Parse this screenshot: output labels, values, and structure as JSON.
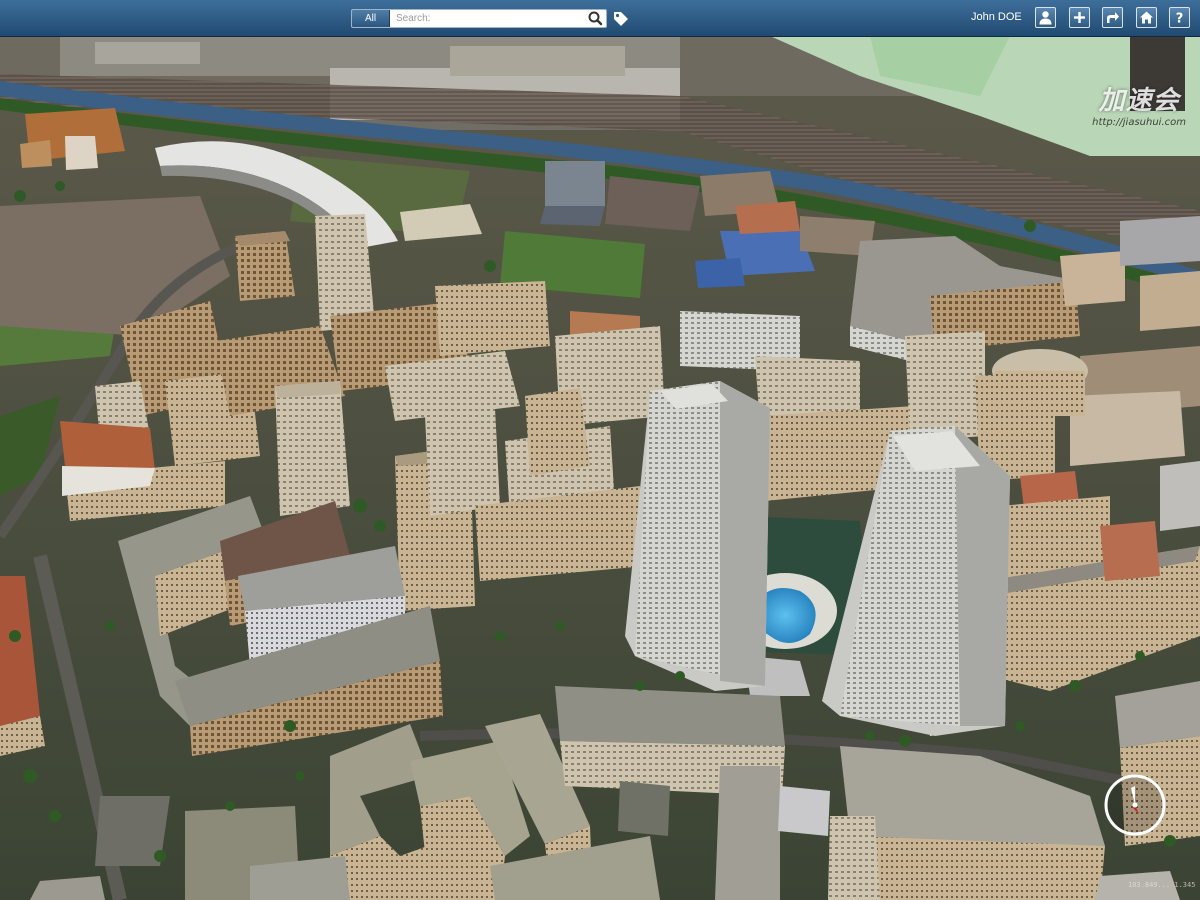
{
  "topbar": {
    "scope_label": "All",
    "search_placeholder": "Search:",
    "user_name": "John DOE",
    "icons": [
      "search-icon",
      "tag-icon",
      "user-icon",
      "add-icon",
      "share-icon",
      "home-icon",
      "help-icon"
    ]
  },
  "watermark": {
    "logo_text": "加速会",
    "url": "http://jiasuhui.com"
  },
  "map": {
    "coordinate_readout": "103.849... 1.345"
  },
  "colors": {
    "topbar": "#2c5a85",
    "vegetation": "#3f6b2e",
    "river": "#3c5f85",
    "pool": "#3d9ad4",
    "compass_needle": "#d02020"
  }
}
